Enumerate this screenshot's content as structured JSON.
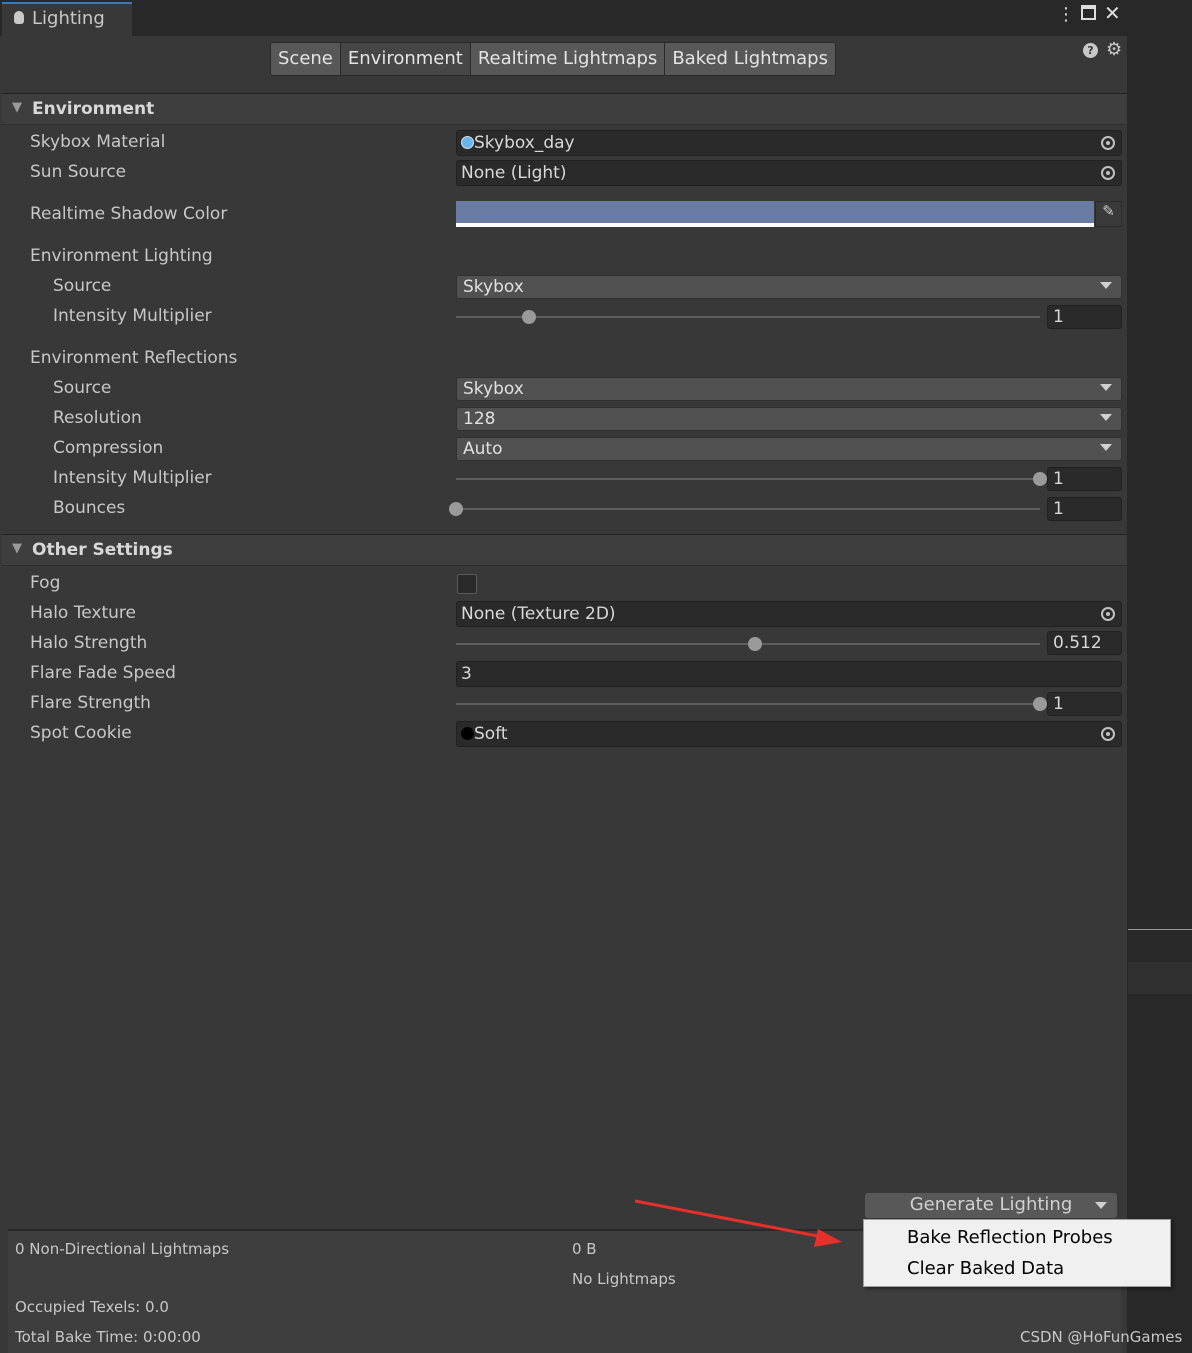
{
  "window": {
    "title": "Lighting",
    "icons": [
      "kebab-menu-icon",
      "maximize-icon",
      "close-icon"
    ]
  },
  "tabs": [
    {
      "label": "Scene"
    },
    {
      "label": "Environment",
      "selected": true
    },
    {
      "label": "Realtime Lightmaps"
    },
    {
      "label": "Baked Lightmaps"
    }
  ],
  "environment": {
    "header": "Environment",
    "skybox_material": {
      "label": "Skybox Material",
      "value": "Skybox_day"
    },
    "sun_source": {
      "label": "Sun Source",
      "value": "None (Light)"
    },
    "realtime_shadow_color": {
      "label": "Realtime Shadow Color",
      "color": "#6a7ba4"
    },
    "lighting": {
      "label": "Environment Lighting",
      "source_label": "Source",
      "source": "Skybox",
      "intensity_label": "Intensity Multiplier",
      "intensity": "1",
      "intensity_range": [
        0,
        8
      ]
    },
    "reflections": {
      "label": "Environment Reflections",
      "source_label": "Source",
      "source": "Skybox",
      "resolution_label": "Resolution",
      "resolution": "128",
      "compression_label": "Compression",
      "compression": "Auto",
      "intensity_label": "Intensity Multiplier",
      "intensity": "1",
      "intensity_range": [
        0,
        1
      ],
      "bounces_label": "Bounces",
      "bounces": "1",
      "bounces_range": [
        1,
        5
      ]
    }
  },
  "other": {
    "header": "Other Settings",
    "fog": {
      "label": "Fog",
      "checked": false
    },
    "halo_texture": {
      "label": "Halo Texture",
      "value": "None (Texture 2D)"
    },
    "halo_strength": {
      "label": "Halo Strength",
      "value": "0.512",
      "range": [
        0,
        1
      ]
    },
    "flare_fade_speed": {
      "label": "Flare Fade Speed",
      "value": "3"
    },
    "flare_strength": {
      "label": "Flare Strength",
      "value": "1",
      "range": [
        0,
        1
      ]
    },
    "spot_cookie": {
      "label": "Spot Cookie",
      "value": "Soft"
    }
  },
  "generate": {
    "label": "Generate Lighting",
    "menu": [
      "Bake Reflection Probes",
      "Clear Baked Data"
    ]
  },
  "stats": {
    "lightmaps": "0 Non-Directional Lightmaps",
    "size": "0 B",
    "no_lightmaps": "No Lightmaps",
    "occupied": "Occupied Texels: 0.0",
    "bake_time": "Total Bake Time: 0:00:00"
  },
  "watermark": "CSDN @HoFunGames",
  "colors": {
    "accent": "#3a79bb",
    "arrow": "#e8302a"
  }
}
